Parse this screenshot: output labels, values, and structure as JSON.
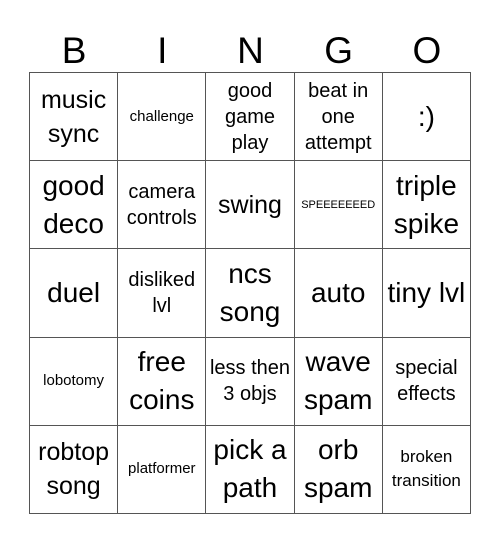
{
  "header": [
    "B",
    "I",
    "N",
    "G",
    "O"
  ],
  "cells": [
    {
      "text": "music sync",
      "size": "s-l"
    },
    {
      "text": "challenge",
      "size": "s-xs"
    },
    {
      "text": "good game play",
      "size": "s-m"
    },
    {
      "text": "beat in one attempt",
      "size": "s-m"
    },
    {
      "text": ":)",
      "size": "s-xl"
    },
    {
      "text": "good deco",
      "size": "s-xl"
    },
    {
      "text": "camera controls",
      "size": "s-m"
    },
    {
      "text": "swing",
      "size": "s-l"
    },
    {
      "text": "SPEEEEEEED",
      "size": "s-xxs"
    },
    {
      "text": "triple spike",
      "size": "s-xl"
    },
    {
      "text": "duel",
      "size": "s-xl"
    },
    {
      "text": "disliked lvl",
      "size": "s-m"
    },
    {
      "text": "ncs song",
      "size": "s-xl"
    },
    {
      "text": "auto",
      "size": "s-xl"
    },
    {
      "text": "tiny lvl",
      "size": "s-xl"
    },
    {
      "text": "lobotomy",
      "size": "s-xs"
    },
    {
      "text": "free coins",
      "size": "s-xl"
    },
    {
      "text": "less then 3 objs",
      "size": "s-m"
    },
    {
      "text": "wave spam",
      "size": "s-xl"
    },
    {
      "text": "special effects",
      "size": "s-m"
    },
    {
      "text": "robtop song",
      "size": "s-l"
    },
    {
      "text": "platformer",
      "size": "s-xs"
    },
    {
      "text": "pick a path",
      "size": "s-xl"
    },
    {
      "text": "orb spam",
      "size": "s-xl"
    },
    {
      "text": "broken transition",
      "size": "s-s"
    }
  ]
}
